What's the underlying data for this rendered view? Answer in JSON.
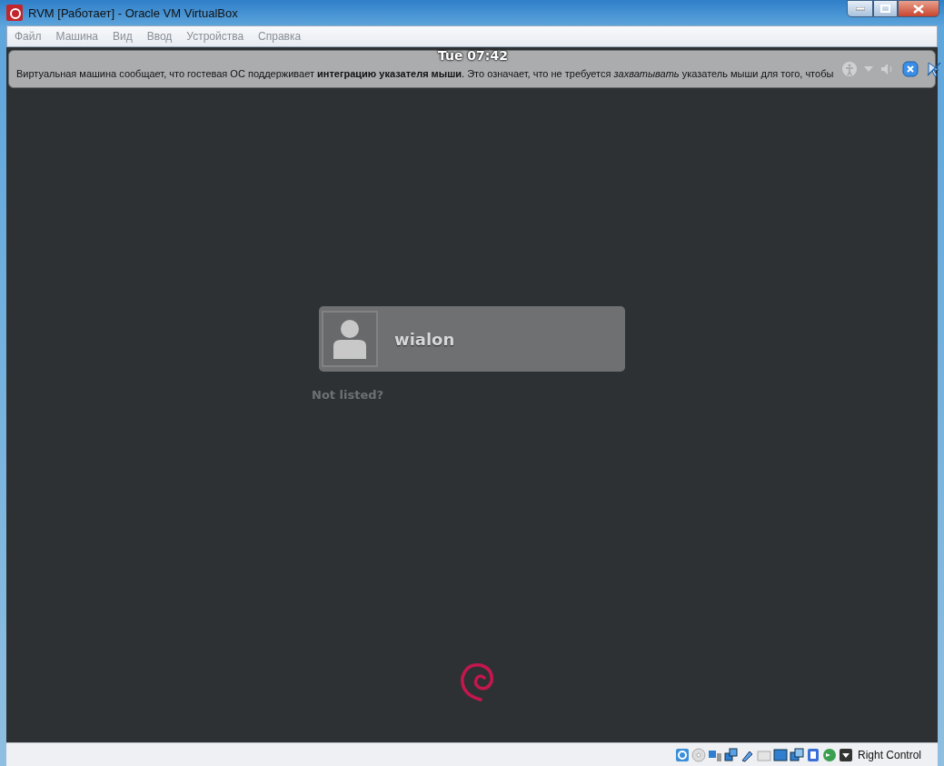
{
  "window": {
    "title": "RVM [Работает] - Oracle VM VirtualBox"
  },
  "menu": [
    "Файл",
    "Машина",
    "Вид",
    "Ввод",
    "Устройства",
    "Справка"
  ],
  "guest": {
    "clock": "Tue 07:42",
    "user": "wialon",
    "not_listed": "Not listed?"
  },
  "notification": {
    "text": "Виртуальная машина сообщает, что гостевая ОС поддерживает **интеграцию указателя мыши**. Это означает, что не требуется *захватывать* указатель мыши для того, чтобы"
  },
  "status_bar": {
    "host_key": "Right Control"
  }
}
